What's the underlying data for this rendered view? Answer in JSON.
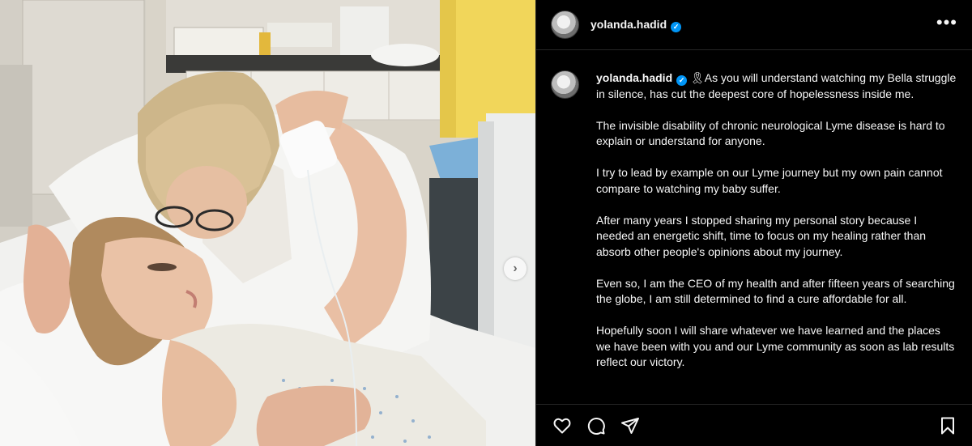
{
  "post": {
    "username": "yolanda.hadid",
    "verified": true,
    "caption": {
      "lead": "🎗As you will understand watching my Bella struggle in silence, has cut the deepest core of hopelessness inside me.",
      "paragraphs": [
        "The invisible disability of chronic neurological Lyme disease is hard to explain or understand for anyone.",
        "I try to lead by example on our Lyme journey but my own pain cannot compare to watching my baby suffer.",
        "After many years I stopped sharing my personal story because I needed an energetic shift, time to focus on my healing rather than absorb other people's opinions about my journey.",
        "Even so, I am the CEO of my health and after fifteen years of searching the globe, I am still determined to find a cure affordable for all.",
        "Hopefully soon I will share whatever we have learned and the places we have been with you and our Lyme community as soon as lab results reflect our victory."
      ]
    }
  },
  "header": {
    "more_label": "•••"
  },
  "media": {
    "next_label": "›"
  },
  "icons": {
    "like": "heart-icon",
    "comment": "comment-icon",
    "share": "send-icon",
    "save": "bookmark-icon",
    "verified": "verified-badge-icon",
    "next": "chevron-right-icon"
  },
  "colors": {
    "background": "#000000",
    "text": "#f5f5f5",
    "verified": "#0095f6",
    "divider": "#262626"
  }
}
